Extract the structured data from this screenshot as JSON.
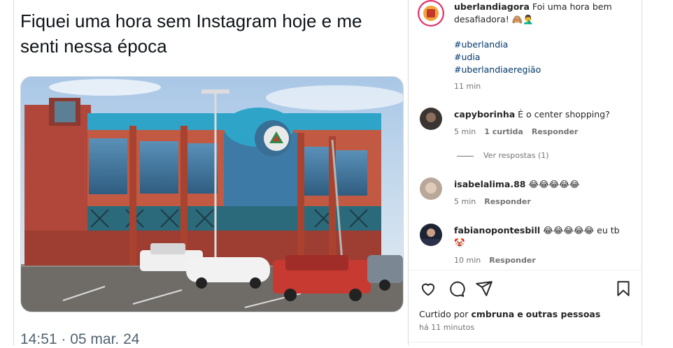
{
  "tweet": {
    "text": "Fiquei uma hora sem Instagram hoje e me senti nessa época",
    "time": "14:51 · 05 mar. 24"
  },
  "caption": {
    "username": "uberlandiagora",
    "text": "Foi uma hora bem desafiadora! 🙈🤦‍♂️",
    "hashtags": [
      "#uberlandia",
      "#udia",
      "#uberlandiaeregião"
    ],
    "time": "11 min"
  },
  "comments": [
    {
      "username": "capyborinha",
      "text": "É o center shopping?",
      "time": "5 min",
      "likes": "1 curtida",
      "reply": "Responder",
      "view_replies": "Ver respostas (1)"
    },
    {
      "username": "isabelalima.88",
      "text": "😂😂😂😂😂",
      "time": "5 min",
      "reply": "Responder"
    },
    {
      "username": "fabianopontesbill",
      "text": "😂😂😂😂😂 eu tb 🤡",
      "time": "10 min",
      "reply": "Responder"
    }
  ],
  "actions": {
    "icons": [
      "heart-icon",
      "comment-icon",
      "share-icon",
      "bookmark-icon"
    ]
  },
  "likes": {
    "prefix": "Curtido por",
    "user": "cmbruna",
    "joiner": "e",
    "others": "outras pessoas"
  },
  "posted": "há 11 minutos",
  "colors": {
    "hashtag": "#00376b",
    "meta": "#737373",
    "text": "#262626",
    "border": "#dbdbdb"
  }
}
